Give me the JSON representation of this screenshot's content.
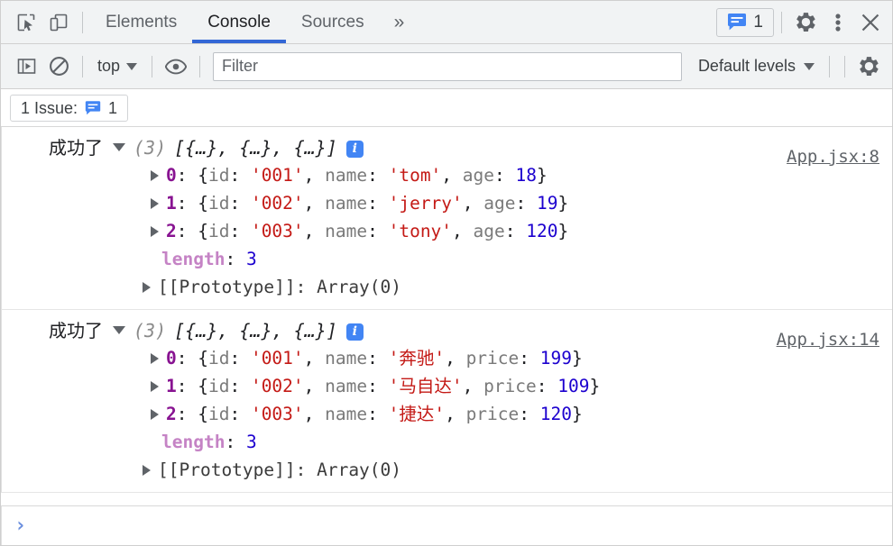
{
  "tabbar": {
    "inspect_icon": "inspect-cursor-icon",
    "device_icon": "device-toolbar-icon",
    "tabs": [
      {
        "label": "Elements",
        "active": false
      },
      {
        "label": "Console",
        "active": true
      },
      {
        "label": "Sources",
        "active": false
      }
    ],
    "more_tabs_label": "»",
    "messages_badge": {
      "icon": "message-bubble-icon",
      "count": "1"
    },
    "settings_icon": "gear-icon",
    "kebab_icon": "more-vertical-icon",
    "close_icon": "close-icon"
  },
  "filterbar": {
    "sidebar_toggle_icon": "console-sidebar-icon",
    "clear_icon": "clear-console-icon",
    "context": "top",
    "eye_icon": "live-expression-icon",
    "filter_placeholder": "Filter",
    "filter_value": "",
    "levels": "Default levels",
    "settings_icon": "gear-icon"
  },
  "issuesbar": {
    "label": "1 Issue:",
    "icon": "message-bubble-icon",
    "count": "1"
  },
  "console": {
    "groups": [
      {
        "label": "成功了",
        "count": "(3)",
        "preview": "[{…}, {…}, {…}]",
        "badge": "i",
        "source": "App.jsx:8",
        "items": [
          {
            "index": "0",
            "fields": [
              {
                "key": "id",
                "value": "'001'",
                "kind": "string"
              },
              {
                "key": "name",
                "value": "'tom'",
                "kind": "string"
              },
              {
                "key": "age",
                "value": "18",
                "kind": "number"
              }
            ]
          },
          {
            "index": "1",
            "fields": [
              {
                "key": "id",
                "value": "'002'",
                "kind": "string"
              },
              {
                "key": "name",
                "value": "'jerry'",
                "kind": "string"
              },
              {
                "key": "age",
                "value": "19",
                "kind": "number"
              }
            ]
          },
          {
            "index": "2",
            "fields": [
              {
                "key": "id",
                "value": "'003'",
                "kind": "string"
              },
              {
                "key": "name",
                "value": "'tony'",
                "kind": "string"
              },
              {
                "key": "age",
                "value": "120",
                "kind": "number"
              }
            ]
          }
        ],
        "length_key": "length",
        "length_value": "3",
        "prototype": "[[Prototype]]: Array(0)"
      },
      {
        "label": "成功了",
        "count": "(3)",
        "preview": "[{…}, {…}, {…}]",
        "badge": "i",
        "source": "App.jsx:14",
        "items": [
          {
            "index": "0",
            "fields": [
              {
                "key": "id",
                "value": "'001'",
                "kind": "string"
              },
              {
                "key": "name",
                "value": "'奔驰'",
                "kind": "string"
              },
              {
                "key": "price",
                "value": "199",
                "kind": "number"
              }
            ]
          },
          {
            "index": "1",
            "fields": [
              {
                "key": "id",
                "value": "'002'",
                "kind": "string"
              },
              {
                "key": "name",
                "value": "'马自达'",
                "kind": "string"
              },
              {
                "key": "price",
                "value": "109",
                "kind": "number"
              }
            ]
          },
          {
            "index": "2",
            "fields": [
              {
                "key": "id",
                "value": "'003'",
                "kind": "string"
              },
              {
                "key": "name",
                "value": "'捷达'",
                "kind": "string"
              },
              {
                "key": "price",
                "value": "120",
                "kind": "number"
              }
            ]
          }
        ],
        "length_key": "length",
        "length_value": "3",
        "prototype": "[[Prototype]]: Array(0)"
      }
    ]
  },
  "prompt": {
    "chevron": "›",
    "value": "",
    "placeholder": ""
  },
  "colors": {
    "accent": "#3367d6",
    "info_badge": "#4285f4",
    "string": "#c41a16",
    "number": "#1c00cf",
    "index": "#881391",
    "key": "#7a7a7a",
    "length_key": "#c583c5",
    "toolbar_bg": "#f1f3f4"
  }
}
